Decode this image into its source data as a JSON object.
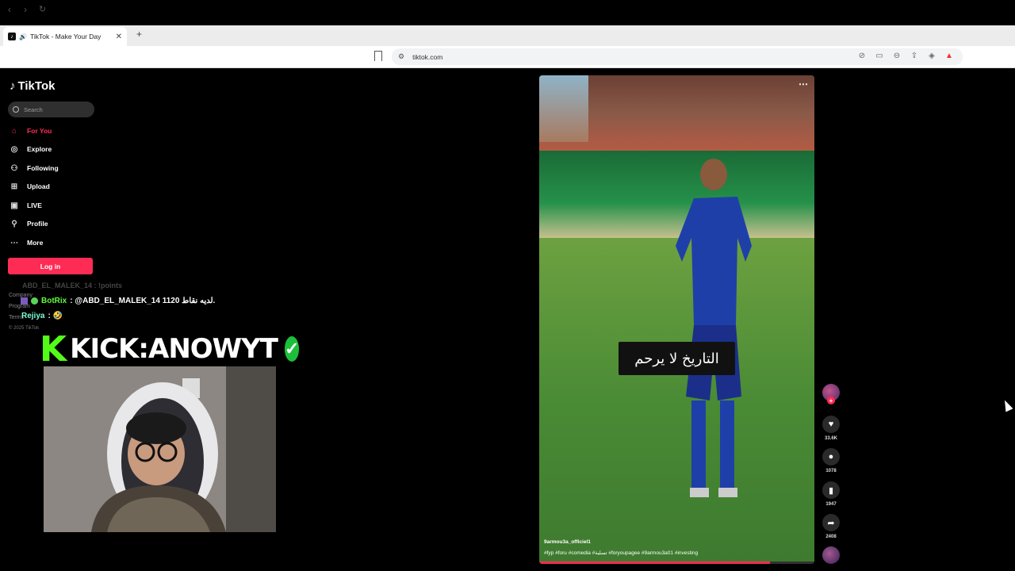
{
  "browser": {
    "tab_title": "TikTok - Make Your Day",
    "new_tab": "+",
    "url": "tiktok.com"
  },
  "tiktok": {
    "logo": "TikTok",
    "search_placeholder": "Search",
    "nav": [
      {
        "label": "For You",
        "icon": "home-icon",
        "active": true
      },
      {
        "label": "Explore",
        "icon": "compass-icon"
      },
      {
        "label": "Following",
        "icon": "following-icon"
      },
      {
        "label": "Upload",
        "icon": "upload-icon"
      },
      {
        "label": "LIVE",
        "icon": "live-icon"
      },
      {
        "label": "Profile",
        "icon": "profile-icon"
      },
      {
        "label": "More",
        "icon": "more-icon"
      }
    ],
    "login": "Log in",
    "footer": [
      "Company",
      "Program",
      "Terms"
    ],
    "copyright": "© 2025 TikTok"
  },
  "stream_overlay": {
    "faded_chat": "ABD_EL_MALEK_14 : !points",
    "chat": [
      {
        "user": "BotRix",
        "message": ": @ABD_EL_MALEK_14 لديه نقاط 1120."
      },
      {
        "user": "Rejiya",
        "message": ": 🤣"
      }
    ],
    "kick_logo": "K",
    "kick_text": "KICK:ANOWYT"
  },
  "video": {
    "caption": "التاريخ لا يرحم",
    "username": "9armou3a_officiel1",
    "hashtags": "#fyp #foru #comedia #تسلية #foryoupagee #9armou3a01 #investing",
    "progress": 0.84,
    "actions": [
      {
        "icon": "heart-icon",
        "count": "33.6K"
      },
      {
        "icon": "comment-icon",
        "count": "1078"
      },
      {
        "icon": "bookmark-icon",
        "count": "1947"
      },
      {
        "icon": "share-icon",
        "count": "2408"
      }
    ]
  }
}
